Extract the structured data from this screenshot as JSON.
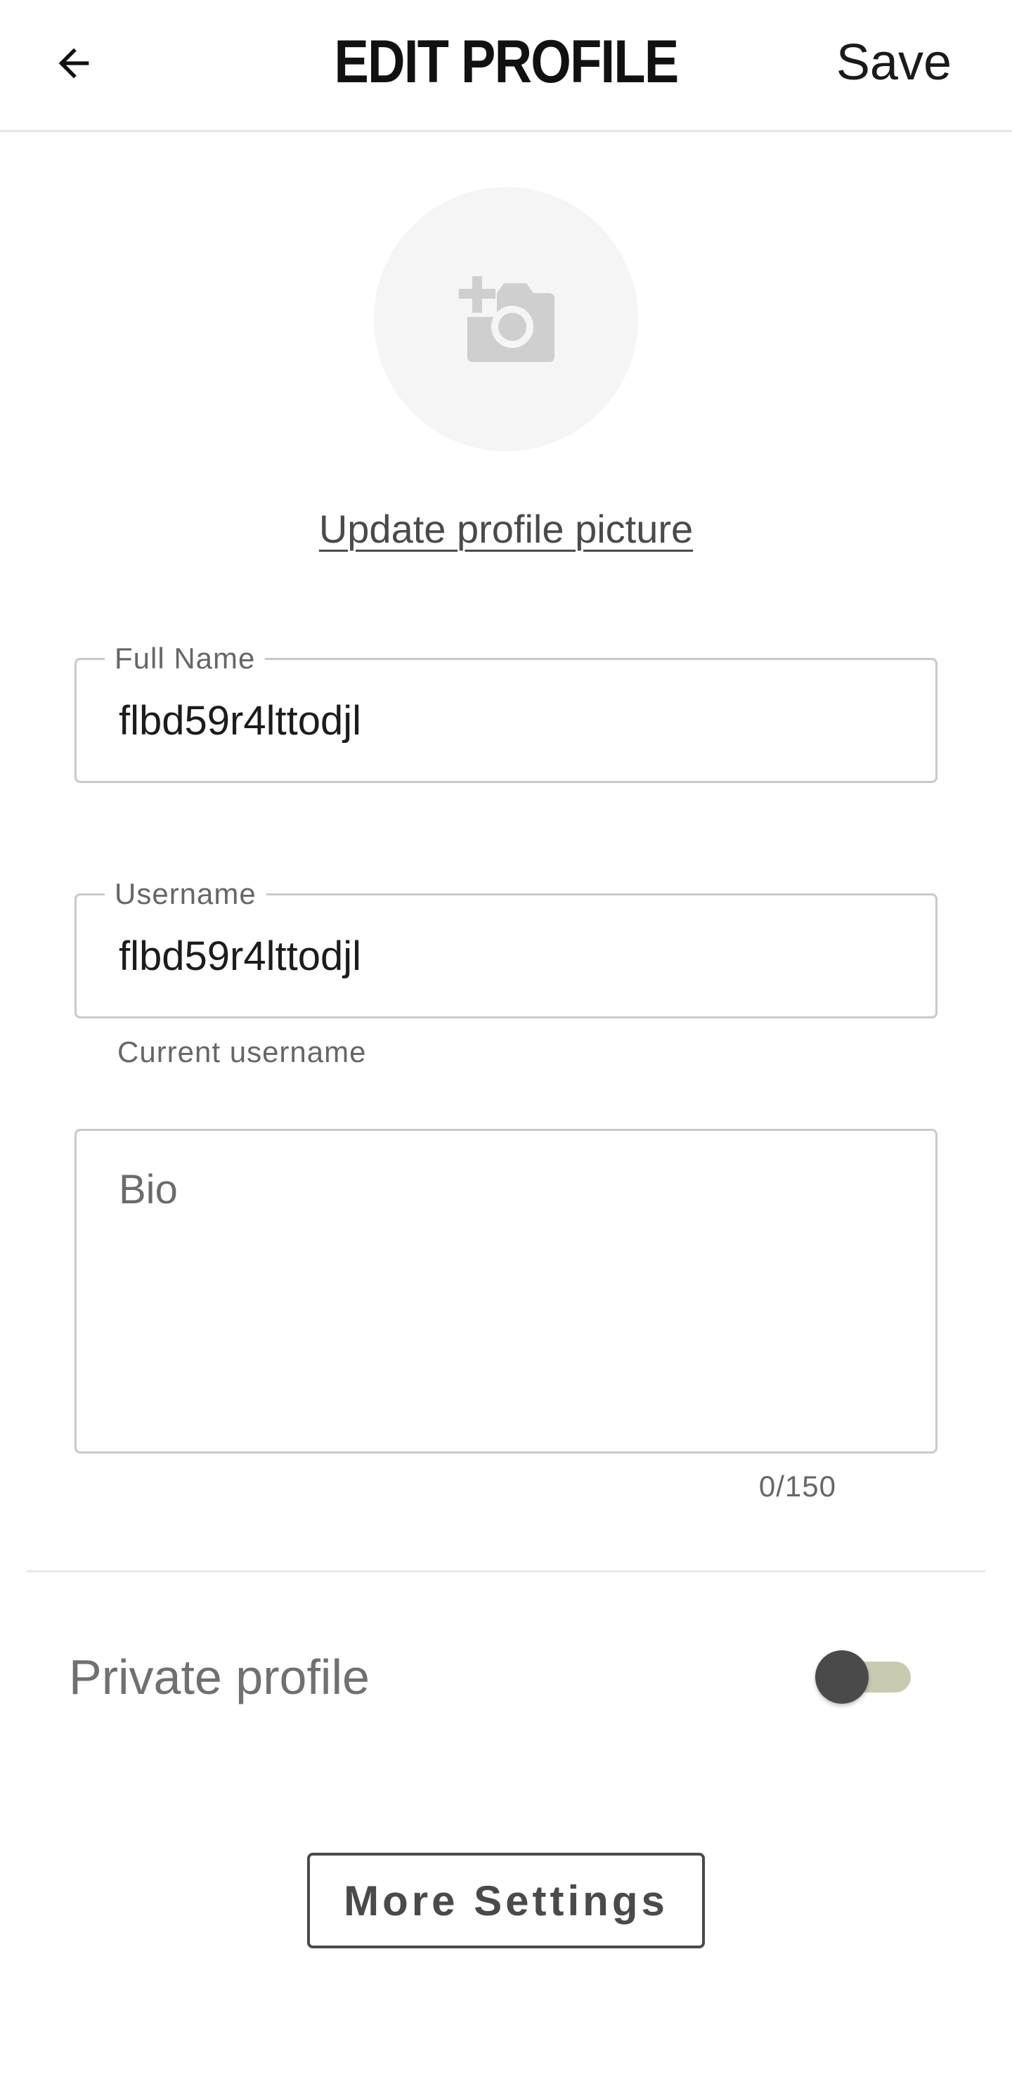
{
  "header": {
    "title": "EDIT PROFILE",
    "save_label": "Save",
    "back_icon": "arrow-left-icon"
  },
  "avatar": {
    "icon": "add-photo-camera-icon",
    "update_link": "Update profile picture"
  },
  "form": {
    "full_name": {
      "label": "Full Name",
      "value": "flbd59r4lttodjl"
    },
    "username": {
      "label": "Username",
      "value": "flbd59r4lttodjl",
      "helper": "Current username"
    },
    "bio": {
      "placeholder": "Bio",
      "counter": "0/150"
    }
  },
  "privacy": {
    "label": "Private profile",
    "enabled": false
  },
  "more_settings_label": "More Settings",
  "colors": {
    "accent_track": "#c8cbb0",
    "thumb": "#4a4a4a",
    "border": "#c9c9c9"
  }
}
